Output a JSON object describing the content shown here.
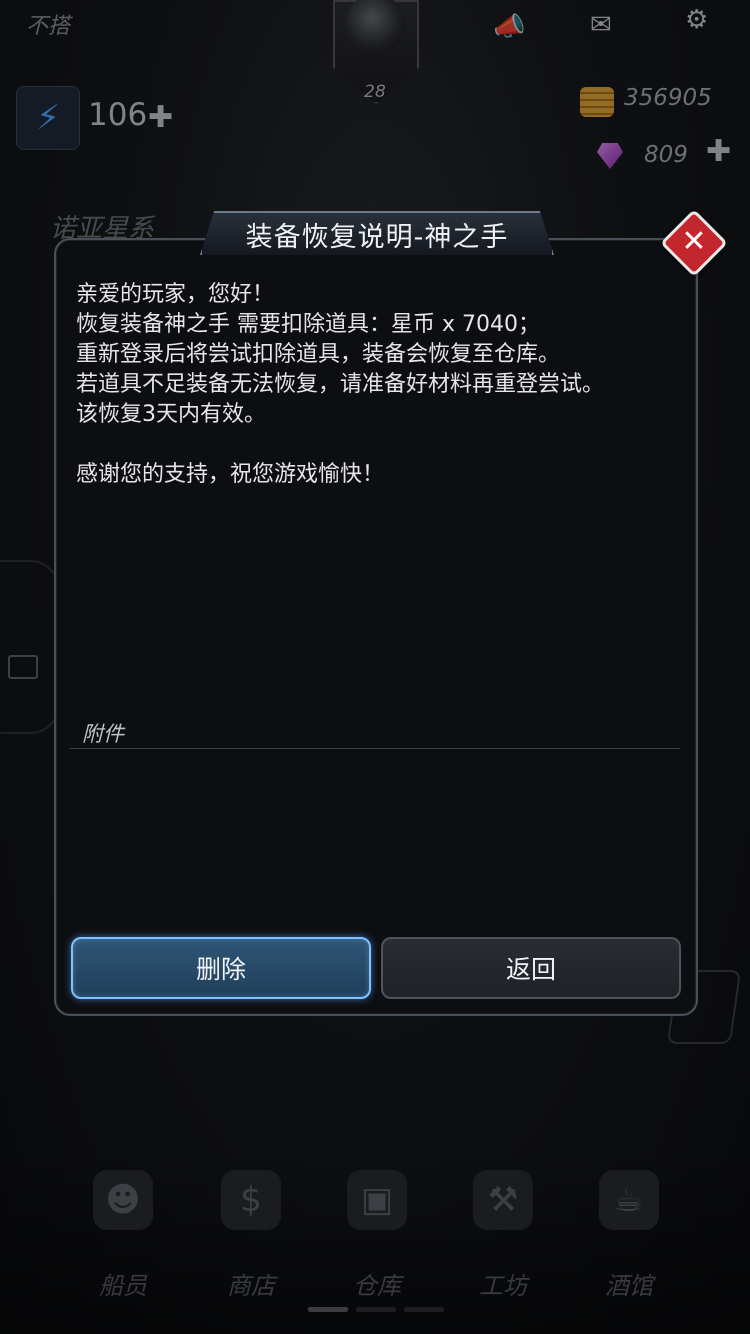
{
  "status": {
    "carrier": "不搭"
  },
  "header": {
    "level": "28",
    "energy": "106",
    "gold": "356905",
    "gems": "809",
    "galaxy": "诺亚星系"
  },
  "dialog": {
    "title": "装备恢复说明-神之手",
    "message_lines": [
      "亲爱的玩家，您好！",
      "恢复装备神之手 需要扣除道具：星币 x 7040；",
      "重新登录后将尝试扣除道具，装备会恢复至仓库。",
      "若道具不足装备无法恢复，请准备好材料再重登尝试。",
      "该恢复3天内有效。"
    ],
    "closing_line": "感谢您的支持，祝您游戏愉快！",
    "attachments_label": "附件",
    "delete_label": "删除",
    "back_label": "返回"
  },
  "nav": {
    "items": [
      {
        "label": "船员",
        "icon": "crew-icon"
      },
      {
        "label": "商店",
        "icon": "shop-icon"
      },
      {
        "label": "仓库",
        "icon": "warehouse-icon"
      },
      {
        "label": "工坊",
        "icon": "workshop-icon"
      },
      {
        "label": "酒馆",
        "icon": "tavern-icon"
      }
    ]
  },
  "colors": {
    "accent": "#7ec3ff",
    "close": "#c4262d",
    "gold": "#e0a63a",
    "gem": "#c35ee0"
  }
}
